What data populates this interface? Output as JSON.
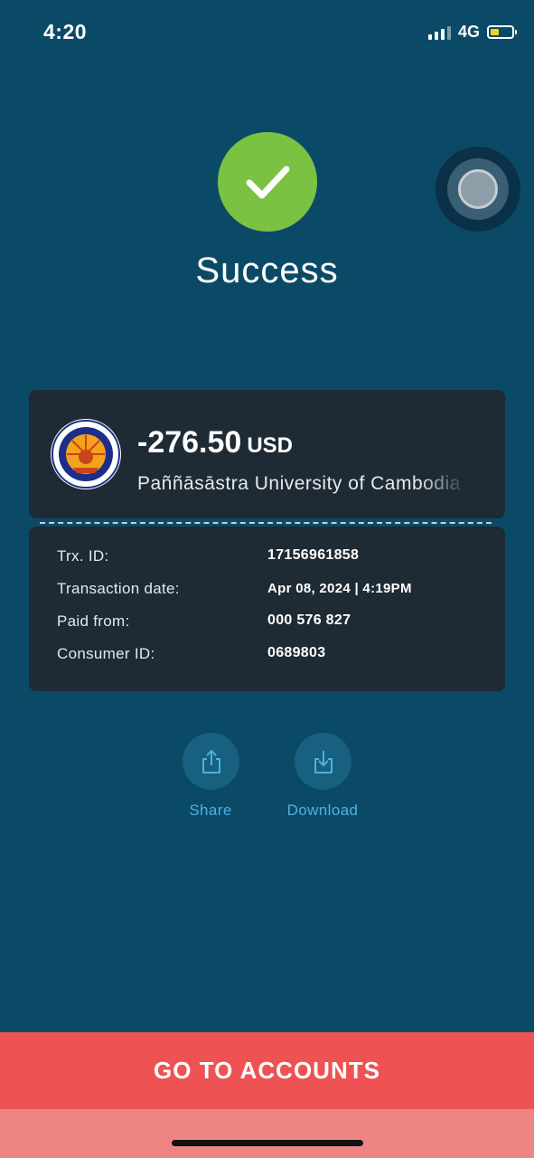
{
  "status_bar": {
    "time": "4:20",
    "network": "4G",
    "battery_color": "#f2d22b"
  },
  "result": {
    "title": "Success",
    "color": "#7cc242"
  },
  "receipt": {
    "amount": "-276.50",
    "currency": "USD",
    "merchant": "Paññāsāstra University of Cambodia",
    "details": [
      {
        "label": "Trx. ID:",
        "value": "17156961858"
      },
      {
        "label": "Transaction date:",
        "value": "Apr 08, 2024 | 4:19PM"
      },
      {
        "label": "Paid from:",
        "value": "000 576 827"
      },
      {
        "label": "Consumer ID:",
        "value": "0689803"
      }
    ]
  },
  "actions": {
    "share": {
      "label": "Share",
      "icon": "share-icon"
    },
    "download": {
      "label": "Download",
      "icon": "download-icon"
    }
  },
  "footer": {
    "button_label": "GO TO ACCOUNTS",
    "button_color": "#ee5253"
  }
}
